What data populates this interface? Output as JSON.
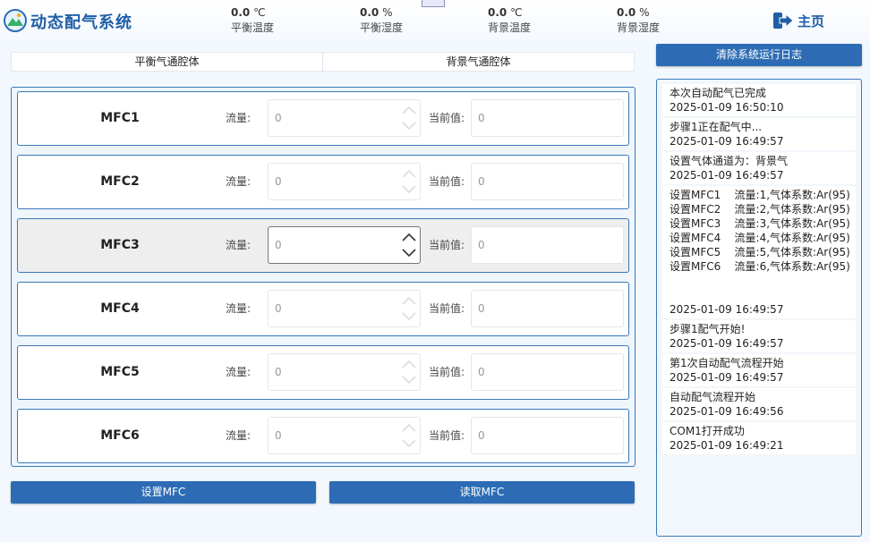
{
  "header": {
    "title": "动态配气系统",
    "home_label": "主页",
    "metrics": [
      {
        "value": "0.0",
        "unit": "℃",
        "label": "平衡温度"
      },
      {
        "value": "0.0",
        "unit": "%",
        "label": "平衡湿度"
      },
      {
        "value": "0.0",
        "unit": "℃",
        "label": "背景温度"
      },
      {
        "value": "0.0",
        "unit": "%",
        "label": "背景湿度"
      }
    ]
  },
  "tabs": [
    "平衡气通腔体",
    "背景气通腔体"
  ],
  "mfc": {
    "flow_label": "流量:",
    "current_label": "当前值:",
    "rows": [
      {
        "name": "MFC1",
        "flow": "0",
        "current": "0"
      },
      {
        "name": "MFC2",
        "flow": "0",
        "current": "0"
      },
      {
        "name": "MFC3",
        "flow": "0",
        "current": "0"
      },
      {
        "name": "MFC4",
        "flow": "0",
        "current": "0"
      },
      {
        "name": "MFC5",
        "flow": "0",
        "current": "0"
      },
      {
        "name": "MFC6",
        "flow": "0",
        "current": "0"
      }
    ]
  },
  "buttons": {
    "set_mfc": "设置MFC",
    "read_mfc": "读取MFC",
    "clear_log": "清除系统运行日志"
  },
  "log": [
    "本次自动配气已完成\n2025-01-09 16:50:10",
    "步骤1正在配气中...\n2025-01-09 16:49:57",
    "设置气体通道为：背景气\n2025-01-09 16:49:57",
    "设置MFC1    流量:1,气体系数:Ar(95)\n设置MFC2    流量:2,气体系数:Ar(95)\n设置MFC3    流量:3,气体系数:Ar(95)\n设置MFC4    流量:4,气体系数:Ar(95)\n设置MFC5    流量:5,气体系数:Ar(95)\n设置MFC6    流量:6,气体系数:Ar(95)\n\n\n2025-01-09 16:49:57",
    "步骤1配气开始!\n2025-01-09 16:49:57",
    "第1次自动配气流程开始\n2025-01-09 16:49:57",
    "自动配气流程开始\n2025-01-09 16:49:56",
    "COM1打开成功\n2025-01-09 16:49:21"
  ],
  "colors": {
    "accent": "#2d6cb5",
    "title": "#1f5fa6"
  },
  "icons": {
    "logo": "mountain-logo-icon",
    "home": "exit-arrow-icon",
    "spinner": "chevron-up-down-icon"
  }
}
